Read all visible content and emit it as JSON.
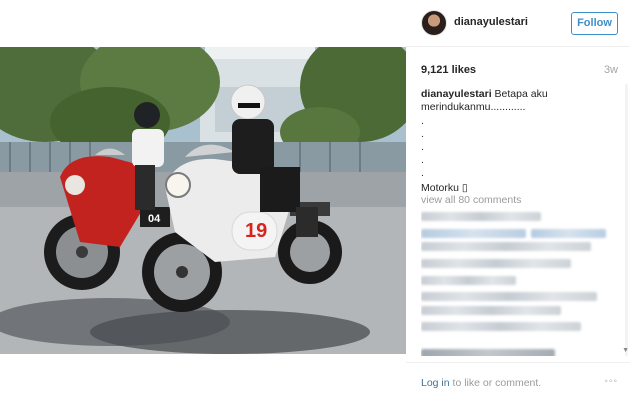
{
  "header": {
    "username": "dianayulestari",
    "follow_label": "Follow"
  },
  "post": {
    "likes": "9,121 likes",
    "time_ago": "3w",
    "caption_user": "dianayulestari",
    "caption_text": "Betapa aku merindukanmu............",
    "caption_dots": [
      ".",
      ".",
      ".",
      ".",
      "."
    ],
    "caption_end": "Motorku ▯",
    "view_all": "view all 80 comments"
  },
  "photo": {
    "bike_front_number": "19",
    "bike_rear_number": "04"
  },
  "footer": {
    "login_link": "Log in",
    "login_rest": "to like or comment.",
    "more_icon": "ellipsis-icon"
  },
  "colors": {
    "accent": "#3f8fc7",
    "link": "#3f729b",
    "muted": "#9b9b9b"
  }
}
